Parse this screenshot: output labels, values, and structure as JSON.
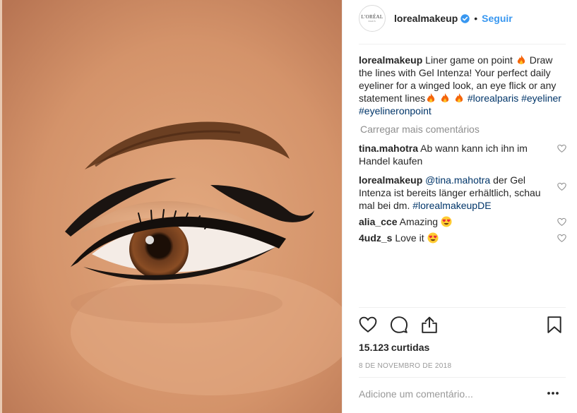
{
  "post": {
    "username": "lorealmakeup",
    "avatar_text": "L'ORÉAL",
    "avatar_subtext": "PARIS",
    "separator_dot": "•",
    "follow_label": "Seguir",
    "verified_icon": "verified-badge-icon",
    "colors": {
      "accent": "#3897f0",
      "hashtag": "#003569",
      "muted": "#8e8e8e"
    }
  },
  "caption": {
    "user": "lorealmakeup",
    "text_1": "Liner game on point",
    "text_2": "Draw the lines with Gel Intenza! Your perfect daily eyeliner for a winged look, an eye flick or any statement lines",
    "hashtags_inline": "#lorealparis",
    "hashtags_rest": "#eyeliner #eyelineronpoint"
  },
  "load_more": "Carregar mais comentários",
  "comments": [
    {
      "user": "tina.mahotra",
      "text": "Ab wann kann ich ihn im Handel kaufen"
    },
    {
      "user": "lorealmakeup",
      "mention": "@tina.mahotra",
      "text": "der Gel Intenza ist bereits länger erhältlich, schau mal bei dm.",
      "hashtag": "#lorealmakeupDE"
    },
    {
      "user": "alia_cce",
      "text": "Amazing",
      "emoji": "heart-eyes-emoji"
    },
    {
      "user": "4udz_s",
      "text": "Love it",
      "emoji": "heart-eyes-emoji"
    }
  ],
  "actions": {
    "like": "heart-icon",
    "comment": "comment-icon",
    "share": "share-icon",
    "save": "bookmark-icon"
  },
  "likes": {
    "count": "15.123",
    "label": "curtidas"
  },
  "date": "8 de novembro de 2018",
  "add_comment": {
    "placeholder": "Adicione um comentário...",
    "menu": "more-options-icon"
  }
}
